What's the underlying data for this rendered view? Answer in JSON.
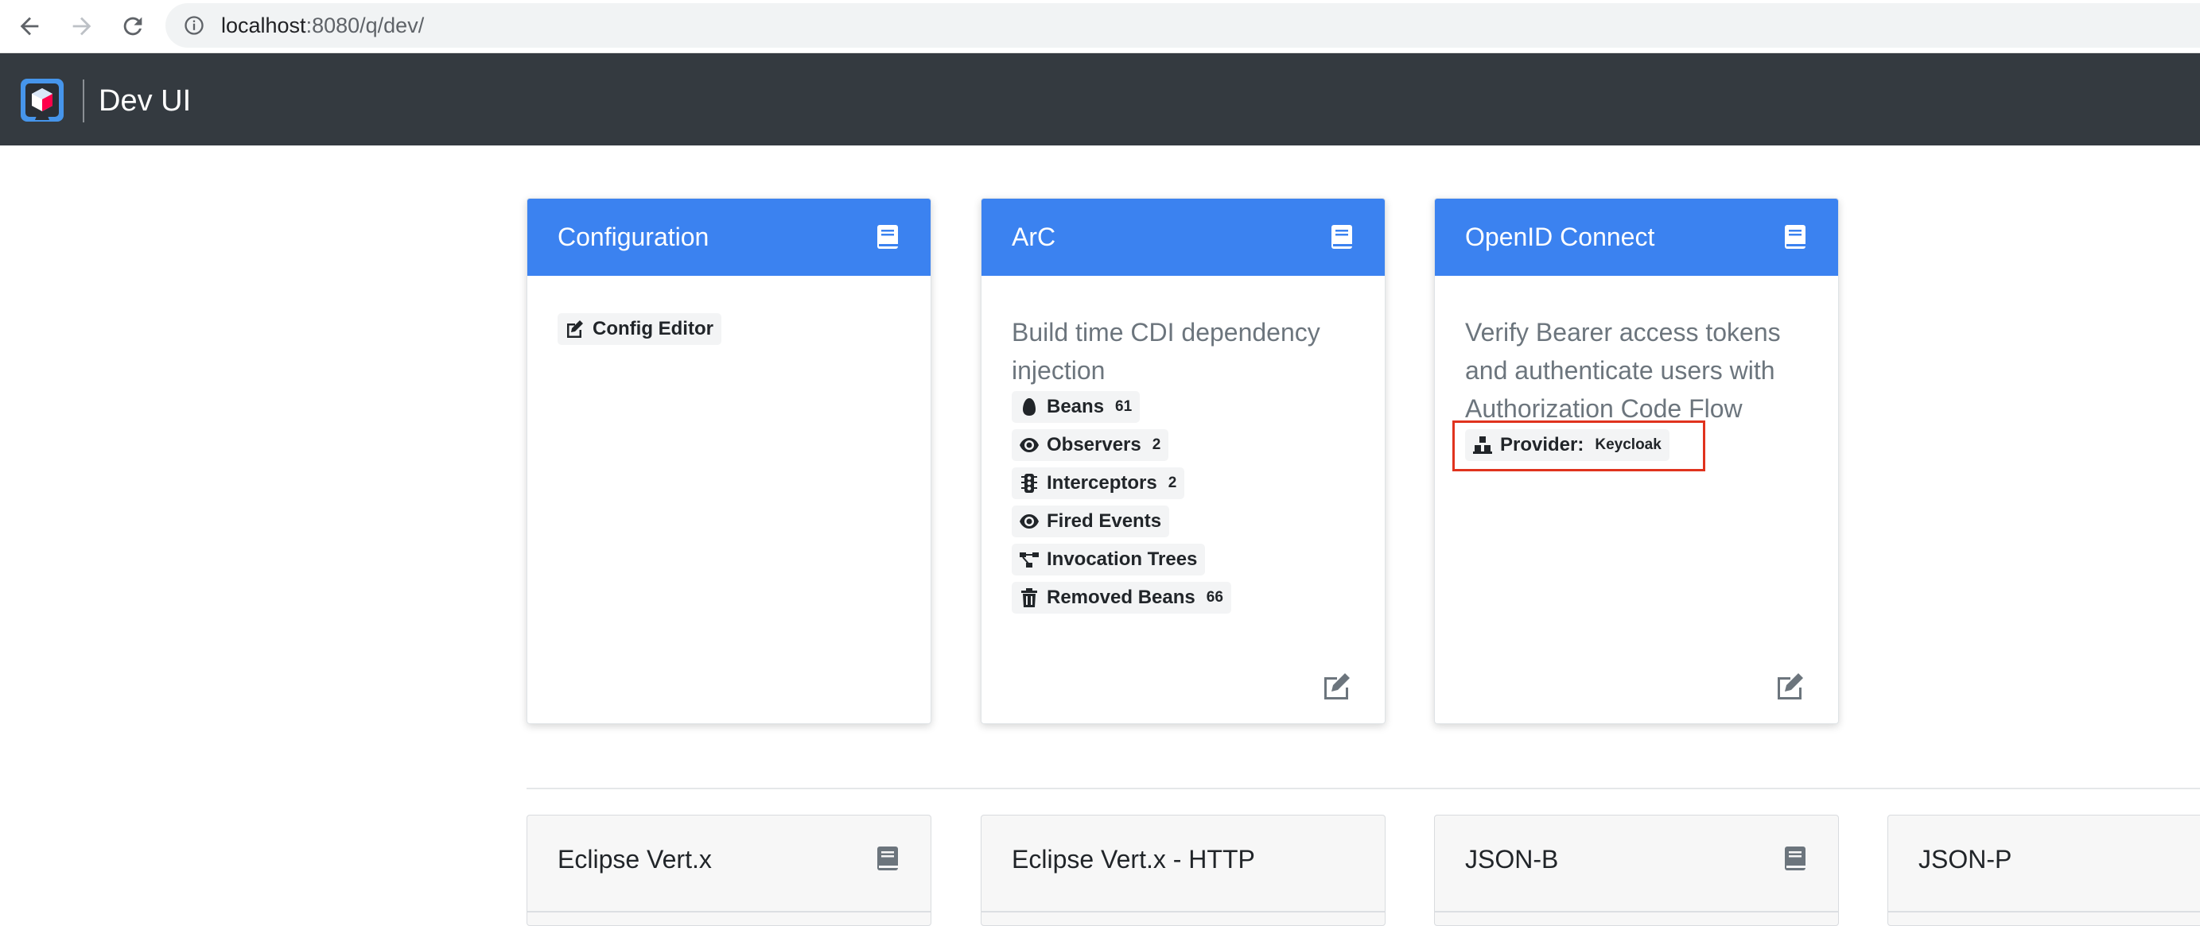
{
  "browser": {
    "url_host": "localhost",
    "url_rest": ":8080/q/dev/"
  },
  "header": {
    "title": "Dev UI"
  },
  "cards": [
    {
      "title": "Configuration",
      "links": [
        {
          "label": "Config Editor",
          "icon": "edit-icon"
        }
      ]
    },
    {
      "title": "ArC",
      "description": "Build time CDI dependency injection",
      "links": [
        {
          "label": "Beans",
          "count": "61",
          "icon": "bean-icon"
        },
        {
          "label": "Observers",
          "count": "2",
          "icon": "eye-icon"
        },
        {
          "label": "Interceptors",
          "count": "2",
          "icon": "traffic-light-icon"
        },
        {
          "label": "Fired Events",
          "count": "",
          "icon": "eye-icon"
        },
        {
          "label": "Invocation Trees",
          "count": "",
          "icon": "project-diagram-icon"
        },
        {
          "label": "Removed Beans",
          "count": "66",
          "icon": "trash-icon"
        }
      ]
    },
    {
      "title": "OpenID Connect",
      "description": "Verify Bearer access tokens and authenticate users with Authorization Code Flow",
      "links": [
        {
          "label": "Provider:",
          "value": "Keycloak",
          "icon": "cubes-icon"
        }
      ]
    }
  ],
  "second_row": [
    {
      "title": "Eclipse Vert.x"
    },
    {
      "title": "Eclipse Vert.x - HTTP"
    },
    {
      "title": "JSON-B"
    },
    {
      "title": "JSON-P"
    }
  ],
  "colors": {
    "card_header": "#3b82f0",
    "app_header": "#343a40",
    "highlight": "#e0331e"
  }
}
